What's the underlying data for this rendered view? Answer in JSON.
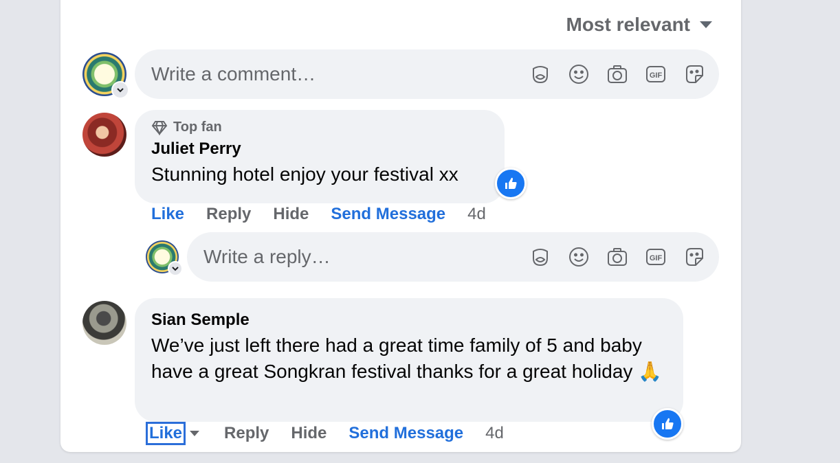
{
  "sort": {
    "label": "Most relevant",
    "icon": "caret-down-icon"
  },
  "composer": {
    "placeholder": "Write a comment…",
    "icons": [
      "avatar-sticker-icon",
      "emoji-icon",
      "camera-icon",
      "gif-icon",
      "sticker-icon"
    ]
  },
  "comments": [
    {
      "badge": "Top fan",
      "author": "Juliet Perry",
      "text": "Stunning hotel enjoy your festival xx",
      "actions": {
        "like": "Like",
        "reply": "Reply",
        "hide": "Hide",
        "send": "Send Message",
        "time": "4d"
      },
      "reply_placeholder": "Write a reply…"
    },
    {
      "author": "Sian Semple",
      "text": "We’ve just left there had a great time family of 5 and baby have a great Songkran festival thanks for a great holiday 🙏",
      "actions": {
        "like": "Like",
        "reply": "Reply",
        "hide": "Hide",
        "send": "Send Message",
        "time": "4d"
      }
    }
  ],
  "colors": {
    "link_blue": "#216fdb",
    "bubble_bg": "#f0f2f5",
    "reaction_blue": "#1877f2"
  }
}
